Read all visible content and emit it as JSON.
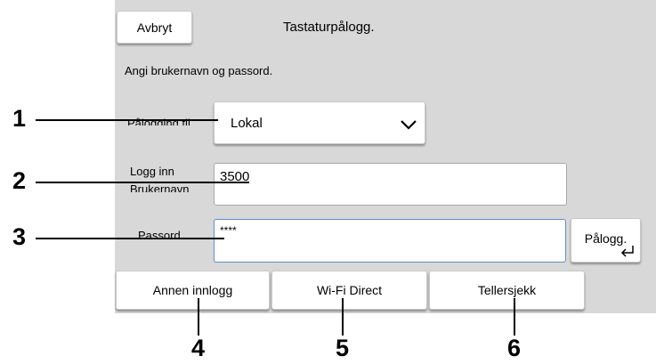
{
  "header": {
    "cancel_label": "Avbryt",
    "title": "Tastaturpålogg."
  },
  "instruction": "Angi brukernavn og passord.",
  "login_to": {
    "label": "Pålogging til",
    "selected": "Lokal",
    "icon": "chevron-down-icon"
  },
  "username": {
    "label_line1": "Logg inn",
    "label_line2": "Brukernavn",
    "value": "3500"
  },
  "password": {
    "label": "Passord",
    "value": "****"
  },
  "login_button": {
    "label": "Pålogg.",
    "icon": "enter-icon"
  },
  "bottom_buttons": [
    "Annen innlogg",
    "Wi-Fi Direct",
    "Tellersjekk"
  ],
  "callouts": [
    "1",
    "2",
    "3",
    "4",
    "5",
    "6"
  ]
}
